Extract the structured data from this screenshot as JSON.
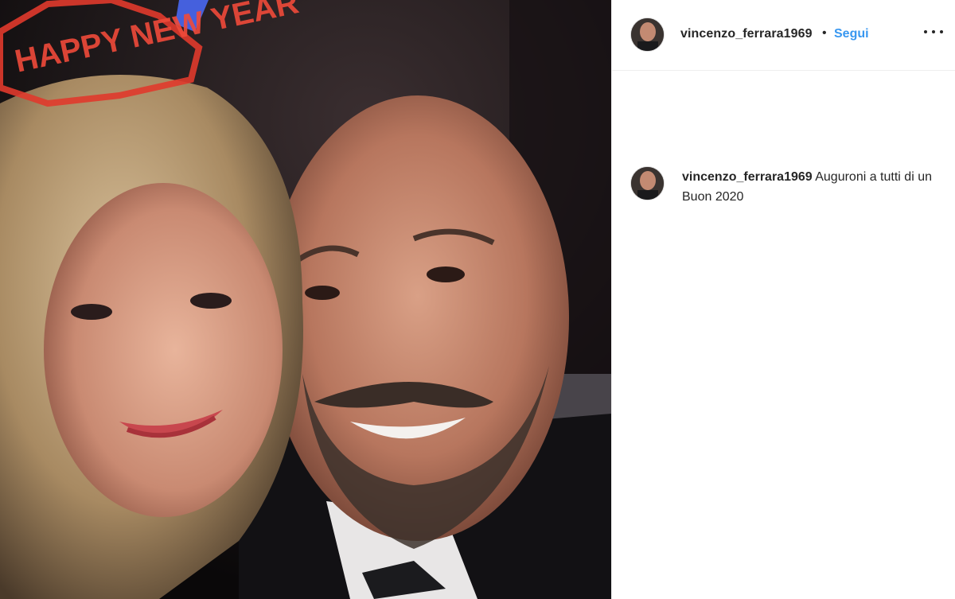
{
  "post": {
    "username": "vincenzo_ferrara1969",
    "separator": "•",
    "follow_label": "Segui",
    "more_icon": "more-horizontal-icon",
    "caption_text": "Auguroni a tutti di un Buon 2020"
  },
  "photo": {
    "headband_text": "HAPPY NEW YEAR"
  },
  "colors": {
    "follow": "#3897f0",
    "text": "#262626",
    "divider": "#efefef"
  }
}
